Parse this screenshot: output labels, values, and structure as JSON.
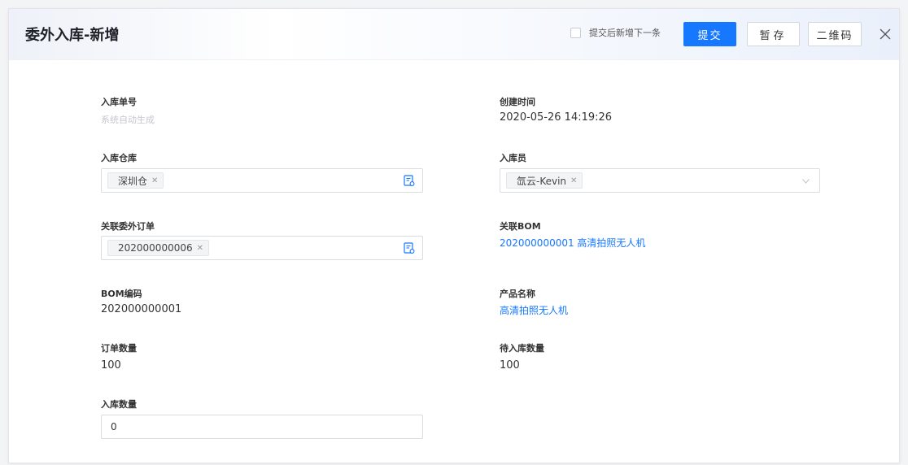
{
  "dialog": {
    "title": "委外入库-新增",
    "checkbox_label": "提交后新增下一条",
    "submit_label": "提交",
    "draft_label": "暂存",
    "qr_label": "二维码"
  },
  "form": {
    "receipt_no": {
      "label": "入库单号",
      "placeholder": "系统自动生成"
    },
    "created_time": {
      "label": "创建时间",
      "value": "2020-05-26 14:19:26"
    },
    "warehouse": {
      "label": "入库仓库",
      "tag": "深圳仓"
    },
    "operator": {
      "label": "入库员",
      "tag": "氙云-Kevin"
    },
    "outsource_order": {
      "label": "关联委外订单",
      "tag": "202000000006"
    },
    "bom": {
      "label": "关联BOM",
      "value": "202000000001 高清拍照无人机"
    },
    "bom_code": {
      "label": "BOM编码",
      "value": "202000000001"
    },
    "product_name": {
      "label": "产品名称",
      "value": "高清拍照无人机"
    },
    "order_qty": {
      "label": "订单数量",
      "value": "100"
    },
    "pending_qty": {
      "label": "待入库数量",
      "value": "100"
    },
    "in_qty": {
      "label": "入库数量",
      "value": "0"
    }
  },
  "colors": {
    "primary": "#1677ff",
    "link": "#1677ff"
  }
}
